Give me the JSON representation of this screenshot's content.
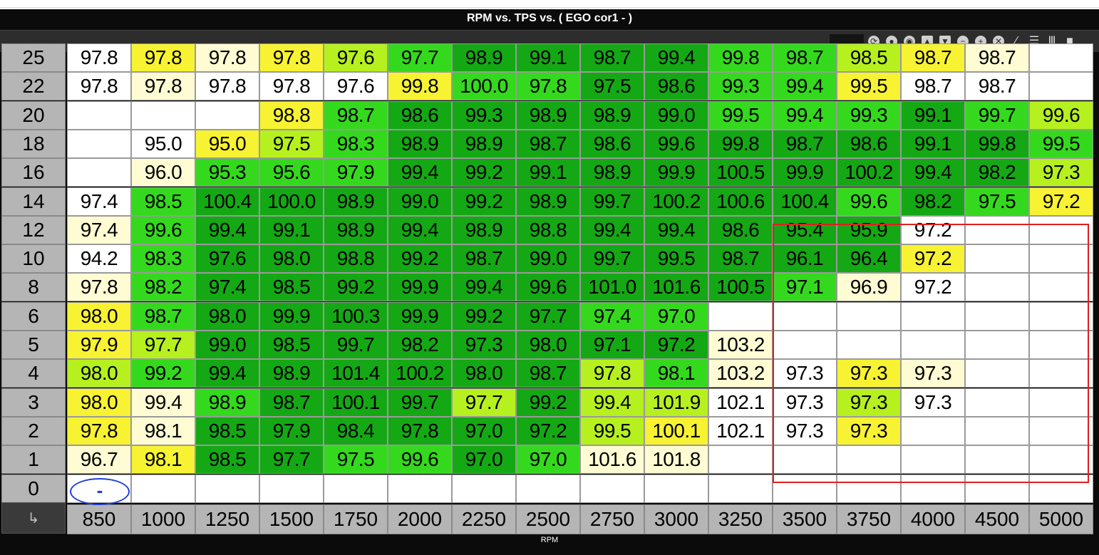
{
  "window": {
    "title": "RPM vs. TPS vs. ( EGO cor1 -   )"
  },
  "toolbar": {
    "icons": [
      "refresh-icon",
      "circle-icon",
      "record-icon",
      "arrow-up-icon",
      "arrow-down-icon",
      "minus-icon",
      "plus-icon",
      "close-icon",
      "pencil-icon",
      "rows-icon",
      "columns-icon",
      "square-icon"
    ],
    "glyphs": [
      "⟳",
      "●",
      "◉",
      "▲",
      "▼",
      "−",
      "+",
      "✕",
      "∕",
      "☰",
      "Ⅲ",
      "■"
    ]
  },
  "table": {
    "rows": [
      "25",
      "22",
      "20",
      "18",
      "16",
      "14",
      "12",
      "10",
      "8",
      "6",
      "5",
      "4",
      "3",
      "2",
      "1",
      "0"
    ],
    "columns": [
      "850",
      "1000",
      "1250",
      "1500",
      "1750",
      "2000",
      "2250",
      "2500",
      "2750",
      "3000",
      "3250",
      "3500",
      "3750",
      "4000",
      "4500",
      "5000"
    ],
    "values": [
      [
        "97.8",
        "97.8",
        "97.8",
        "97.8",
        "97.6",
        "97.7",
        "98.9",
        "99.1",
        "98.7",
        "99.4",
        "99.8",
        "98.7",
        "98.5",
        "98.7",
        "98.7",
        ""
      ],
      [
        "97.8",
        "97.8",
        "97.8",
        "97.8",
        "97.6",
        "99.8",
        "100.0",
        "97.8",
        "97.5",
        "98.6",
        "99.3",
        "99.4",
        "99.5",
        "98.7",
        "98.7",
        ""
      ],
      [
        "",
        "",
        "",
        "98.8",
        "98.7",
        "98.6",
        "99.3",
        "98.9",
        "98.9",
        "99.0",
        "99.5",
        "99.4",
        "99.3",
        "99.1",
        "99.7",
        "99.6"
      ],
      [
        "",
        "95.0",
        "95.0",
        "97.5",
        "98.3",
        "98.9",
        "98.9",
        "98.7",
        "98.6",
        "99.6",
        "99.8",
        "98.7",
        "98.6",
        "99.1",
        "99.8",
        "99.5"
      ],
      [
        "",
        "96.0",
        "95.3",
        "95.6",
        "97.9",
        "99.4",
        "99.2",
        "99.1",
        "98.9",
        "99.9",
        "100.5",
        "99.9",
        "100.2",
        "99.4",
        "98.2",
        "97.3"
      ],
      [
        "97.4",
        "98.5",
        "100.4",
        "100.0",
        "98.9",
        "99.0",
        "99.2",
        "98.9",
        "99.7",
        "100.2",
        "100.6",
        "100.4",
        "99.6",
        "98.2",
        "97.5",
        "97.2"
      ],
      [
        "97.4",
        "99.6",
        "99.4",
        "99.1",
        "98.9",
        "99.4",
        "98.9",
        "98.8",
        "99.4",
        "99.4",
        "98.6",
        "95.4",
        "95.9",
        "97.2",
        "",
        ""
      ],
      [
        "94.2",
        "98.3",
        "97.6",
        "98.0",
        "98.8",
        "99.2",
        "98.7",
        "99.0",
        "99.7",
        "99.5",
        "98.7",
        "96.1",
        "96.4",
        "97.2",
        "",
        ""
      ],
      [
        "97.8",
        "98.2",
        "97.4",
        "98.5",
        "99.2",
        "99.9",
        "99.4",
        "99.6",
        "101.0",
        "101.6",
        "100.5",
        "97.1",
        "96.9",
        "97.2",
        "",
        ""
      ],
      [
        "98.0",
        "98.7",
        "98.0",
        "99.9",
        "100.3",
        "99.9",
        "99.2",
        "97.7",
        "97.4",
        "97.0",
        "",
        "",
        "",
        "",
        "",
        ""
      ],
      [
        "97.9",
        "97.7",
        "99.0",
        "98.5",
        "99.7",
        "98.2",
        "97.3",
        "98.0",
        "97.1",
        "97.2",
        "103.2",
        "",
        "",
        "",
        "",
        ""
      ],
      [
        "98.0",
        "99.2",
        "99.4",
        "98.9",
        "101.4",
        "100.2",
        "98.0",
        "98.7",
        "97.8",
        "98.1",
        "103.2",
        "97.3",
        "97.3",
        "97.3",
        "",
        ""
      ],
      [
        "98.0",
        "99.4",
        "98.9",
        "98.7",
        "100.1",
        "99.7",
        "97.7",
        "99.2",
        "99.4",
        "101.9",
        "102.1",
        "97.3",
        "97.3",
        "97.3",
        "",
        ""
      ],
      [
        "97.8",
        "98.1",
        "98.5",
        "97.9",
        "98.4",
        "97.8",
        "97.0",
        "97.2",
        "99.5",
        "100.1",
        "102.1",
        "97.3",
        "97.3",
        "",
        "",
        ""
      ],
      [
        "96.7",
        "98.1",
        "98.5",
        "97.7",
        "97.5",
        "99.6",
        "97.0",
        "97.0",
        "101.6",
        "101.8",
        "",
        "",
        "",
        "",
        "",
        ""
      ],
      [
        "",
        "",
        "",
        "",
        "",
        "",
        "",
        "",
        "",
        "",
        "",
        "",
        "",
        "",
        "",
        ""
      ]
    ],
    "colors": [
      [
        "w",
        "y",
        "c",
        "y",
        "l",
        "g",
        "d",
        "d",
        "d",
        "d",
        "g",
        "g",
        "l",
        "y",
        "c",
        "w"
      ],
      [
        "w",
        "c",
        "w",
        "w",
        "w",
        "y",
        "g",
        "g",
        "d",
        "d",
        "g",
        "g",
        "y",
        "w",
        "w",
        "w"
      ],
      [
        "w",
        "w",
        "w",
        "y",
        "g",
        "d",
        "d",
        "d",
        "d",
        "d",
        "g",
        "g",
        "g",
        "d",
        "g",
        "l"
      ],
      [
        "w",
        "w",
        "y",
        "l",
        "g",
        "d",
        "d",
        "d",
        "d",
        "d",
        "d",
        "d",
        "d",
        "d",
        "d",
        "g"
      ],
      [
        "w",
        "c",
        "g",
        "g",
        "g",
        "d",
        "d",
        "d",
        "d",
        "d",
        "d",
        "d",
        "d",
        "d",
        "d",
        "l"
      ],
      [
        "w",
        "g",
        "d",
        "d",
        "d",
        "d",
        "d",
        "d",
        "d",
        "d",
        "d",
        "d",
        "g",
        "d",
        "g",
        "y"
      ],
      [
        "c",
        "g",
        "d",
        "d",
        "d",
        "d",
        "d",
        "d",
        "d",
        "d",
        "d",
        "d",
        "d",
        "w",
        "w",
        "w"
      ],
      [
        "w",
        "g",
        "d",
        "d",
        "d",
        "d",
        "d",
        "d",
        "d",
        "d",
        "d",
        "d",
        "d",
        "y",
        "w",
        "w"
      ],
      [
        "c",
        "g",
        "d",
        "d",
        "d",
        "d",
        "d",
        "d",
        "d",
        "d",
        "d",
        "g",
        "c",
        "w",
        "w",
        "w"
      ],
      [
        "y",
        "g",
        "d",
        "d",
        "d",
        "d",
        "d",
        "d",
        "g",
        "g",
        "w",
        "w",
        "w",
        "w",
        "w",
        "w"
      ],
      [
        "y",
        "l",
        "d",
        "d",
        "d",
        "d",
        "d",
        "d",
        "d",
        "d",
        "c",
        "w",
        "w",
        "w",
        "w",
        "w"
      ],
      [
        "l",
        "g",
        "d",
        "d",
        "d",
        "d",
        "d",
        "d",
        "l",
        "g",
        "c",
        "w",
        "y",
        "c",
        "w",
        "w"
      ],
      [
        "y",
        "c",
        "g",
        "d",
        "d",
        "d",
        "l",
        "d",
        "l",
        "l",
        "w",
        "w",
        "l",
        "w",
        "w",
        "w"
      ],
      [
        "y",
        "c",
        "d",
        "d",
        "d",
        "d",
        "d",
        "d",
        "l",
        "y",
        "w",
        "w",
        "y",
        "w",
        "w",
        "w"
      ],
      [
        "c",
        "y",
        "d",
        "d",
        "g",
        "g",
        "d",
        "g",
        "c",
        "c",
        "w",
        "w",
        "w",
        "w",
        "w",
        "w"
      ],
      [
        "w",
        "w",
        "w",
        "w",
        "w",
        "w",
        "w",
        "w",
        "w",
        "w",
        "w",
        "w",
        "w",
        "w",
        "w",
        "w"
      ]
    ],
    "palette": {
      "w": "#ffffff",
      "c": "#fffbd2",
      "y": "#f7f232",
      "l": "#b6f01e",
      "g": "#34d81c",
      "d": "#14a914"
    },
    "cursor_symbol": "-",
    "corner_symbol": "↳",
    "x_axis_title": "RPM"
  }
}
